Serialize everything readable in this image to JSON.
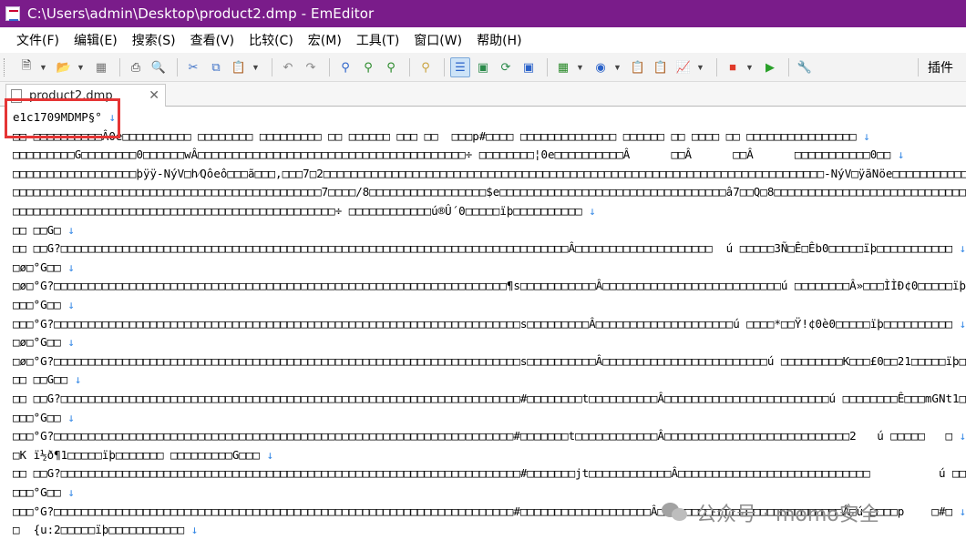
{
  "window": {
    "title": "C:\\Users\\admin\\Desktop\\product2.dmp - EmEditor"
  },
  "menu": [
    "文件(F)",
    "编辑(E)",
    "搜索(S)",
    "查看(V)",
    "比较(C)",
    "宏(M)",
    "工具(T)",
    "窗口(W)",
    "帮助(H)"
  ],
  "toolbar": {
    "plugins_label": "插件",
    "buttons": [
      "new-file-icon",
      "open-folder-icon",
      "save-icon",
      "print-icon",
      "print-preview-icon",
      "cut-icon",
      "copy-icon",
      "paste-icon",
      "undo-icon",
      "redo-icon",
      "find-icon",
      "find-next-icon",
      "find-prev-icon",
      "search-files-icon",
      "view-mode-icon",
      "view-mode-2-icon",
      "refresh-icon",
      "view-mode-3-icon",
      "table-icon",
      "globe-icon",
      "clip-icon",
      "clip2-icon",
      "chart-icon",
      "stop-macro-icon",
      "play-macro-icon",
      "tool-icon"
    ]
  },
  "tab": {
    "label": "product2.dmp",
    "close": "✕"
  },
  "editor": {
    "newline_mark": "↓",
    "lines": [
      "e1c1709MDMP§°",
      "□□ □□□□□□□□□□Â0è□□□□□□□□□□ □□□□□□□□ □□□□□□□□□ □□ □□□□□□ □□□ □□  □□□p#□□□□ □□□□□□□□□□□□□□ □□□□□□ □□ □□□□ □□ □□□□□□□□□□□□□□□□",
      "□□□□□□□□□G□□□□□□□□0□□□□□□wÂ□□□□□□□□□□□□□□□□□□□□□□□□□□□□□□□□□□□□□□□÷ □□□□□□□□¦0e□□□□□□□□□□Â      □□Â      □□Â      □□□□□□□□□□□0□□",
      "□□□□□□□□□□□□□□□□□□þÿÿ-NýV□h⁄Qôeô□□□ã□□□,□□□7□2□□□□□□□□□□□□□□□□□□□□□□□□□□□□□□□□□□□□□□□□□□□□□□□□□□□□□□□□□□□□□□□□□□□□□□□□□-NýV□ÿãNöe□□□□□□□□□□□□",
      "□□□□□□□□□□□□□□□□□□□□□□□□□□□□□□□□□□□□□□□□□□□□□7□□□□/8□□□□□□□□□□□□□□□□□$e□□□□□□□□□□□□□□□□□□□□□□□□□□□□□□□□□â7□□Q□8□□□□□□□□□□□□□□□□□□□□□□□□□□□□□",
      "□□□□□□□□□□□□□□□□□□□□□□□□□□□□□□□□□□□□□□□□□□□□□□□÷ □□□□□□□□□□□□ú®Û´0□□□□□ïþ□□□□□□□□□□",
      "□□ □□G□",
      "□□ □□G?□□□□□□□□□□□□□□□□□□□□□□□□□□□□□□□□□□□□□□□□□□□□□□□□□□□□□□□□□□□□□□□□□□□□□□□□□□Â□□□□□□□□□□□□□□□□□□□□  ú □□□□□3Ñ□Ê□Êb0□□□□□ïþ□□□□□□□□□□□",
      "□ø□°G□□",
      "□ø□°G?□□□□□□□□□□□□□□□□□□□□□□□□□□□□□□□□□□□□□□□□□□□□□□□□□□□□□□□□□□□□□□□□□□¶s□□□□□□□□□□□Â□□□□□□□□□□□□□□□□□□□□□□□□□□ú □□□□□□□□Â»□□□ÌÌĐ¢0□□□□□ïþ□□□□□□□□□□□",
      "□□□°G□□",
      "□□□°G?□□□□□□□□□□□□□□□□□□□□□□□□□□□□□□□□□□□□□□□□□□□□□□□□□□□□□□□□□□□□□□□□□□□□s□□□□□□□□□Â□□□□□□□□□□□□□□□□□□□□ú □□□□*□□Ÿ!¢0è0□□□□□ïþ□□□□□□□□□□",
      "□ø□°G□□",
      "□ø□°G?□□□□□□□□□□□□□□□□□□□□□□□□□□□□□□□□□□□□□□□□□□□□□□□□□□□□□□□□□□□□□□□□□□□□s□□□□□□□□□□Â□□□□□□□□□□□□□□□□□□□□□□□□ú □□□□□□□□□K□□□£0□□21□□□□□ïþ□□□□□□□□□□□□",
      "□□ □□G□□",
      "□□ □□G?□□□□□□□□□□□□□□□□□□□□□□□□□□□□□□□□□□□□□□□□□□□□□□□□□□□□□□□□□□□□□□□□□□□#□□□□□□□□t□□□□□□□□□□Â□□□□□□□□□□□□□□□□□□□□□□□□ú □□□□□□□□Ê□□□mGNt1□□□□□ïþ□□□□□□□□□□□",
      "□□□°G□□",
      "□□□°G?□□□□□□□□□□□□□□□□□□□□□□□□□□□□□□□□□□□□□□□□□□□□□□□□□□□□□□□□□□□□□□□□□□□#□□□□□□□t□□□□□□□□□□□□Â□□□□□□□□□□□□□□□□□□□□□□□□□□□2   ú □□□□□   □",
      "□K ï½ð¶1□□□□□ïþ□□□□□□□ □□□□□□□□□G□□□",
      "□□ □□G?□□□□□□□□□□□□□□□□□□□□□□□□□□□□□□□□□□□□□□□□□□□□□□□□□□□□□□□□□□□□□□□□□□□#□□□□□□□jt□□□□□□□□□□□□Â□□□□□□□□□□□□□□□□□□□□□□□□□□□□          ú □□□□□□□□□□□□□□□□aPø1□□□□□ïþ□□□□□□□□□□□",
      "□□□°G□□",
      "□□□°G?□□□□□□□□□□□□□□□□□□□□□□□□□□□□□□□□□□□□□□□□□□□□□□□□□□□□□□□□□□□□□□□□□□□#□□□□□□□□□□□□□□□□□□□Â□□□□□□□□□□□□□□□□□□□□□□□□□□□Â□ú □□□□p    □#□",
      "□  {u:2□□□□□ïþ□□□□□□□□□□□"
    ]
  },
  "watermark": {
    "text": "公众号 · momo安全",
    "icon": "wechat-icon"
  },
  "colors": {
    "titlebar": "#7a1c8a",
    "highlight": "#e53535",
    "newline": "#3a8be6"
  }
}
